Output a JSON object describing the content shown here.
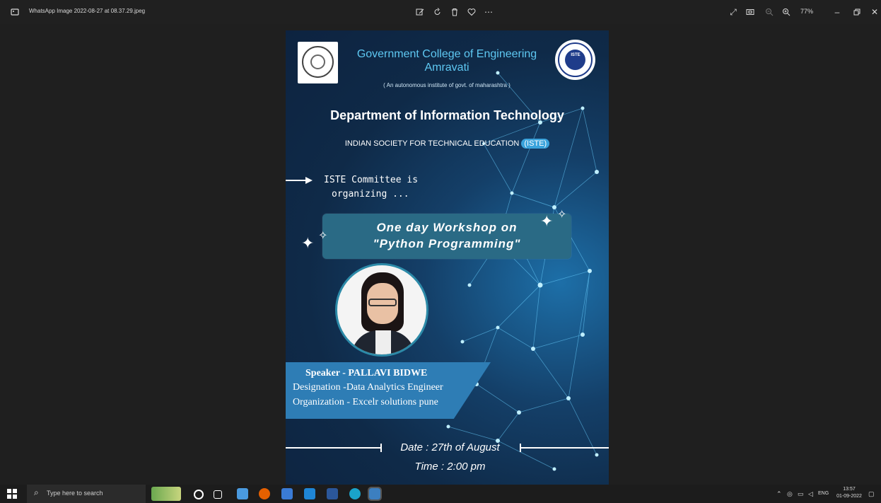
{
  "window": {
    "filename": "WhatsApp Image 2022-08-27 at 08.37.29.jpeg",
    "zoom": "77%",
    "toolbar_icons": [
      "edit-icon",
      "rotate-icon",
      "delete-icon",
      "favorite-icon",
      "more-icon"
    ],
    "right_icons": [
      "fullscreen-icon",
      "fit-icon",
      "zoom-out-icon",
      "zoom-in-icon"
    ],
    "window_controls": [
      "minimize-icon",
      "restore-icon",
      "close-icon"
    ]
  },
  "poster": {
    "college_line1": "Government College of Engineering",
    "college_line2": "Amravati",
    "autonomous": "( An autonomous institute of govt. of maharashtra )",
    "iste_logo_label": "ISTE",
    "department": "Department of Information Technology",
    "society_prefix": "INDIAN SOCIETY FOR TECHNICAL EDUCATION",
    "society_abbr": "(ISTE)",
    "committee_line1": "ISTE Committee is",
    "committee_line2": "organizing ...",
    "workshop_line1": "One day Workshop on",
    "workshop_line2": "\"Python Programming\"",
    "speaker": "Speaker - PALLAVI BIDWE",
    "designation": "Designation -Data Analytics Engineer",
    "organization": "Organization - Excelr solutions pune",
    "date": "Date : 27th of August",
    "time": "Time : 2:00 pm"
  },
  "taskbar": {
    "search_placeholder": "Type here to search",
    "tray_lang": "ENG",
    "clock_time": "13:57",
    "clock_date": "01-09-2022"
  }
}
